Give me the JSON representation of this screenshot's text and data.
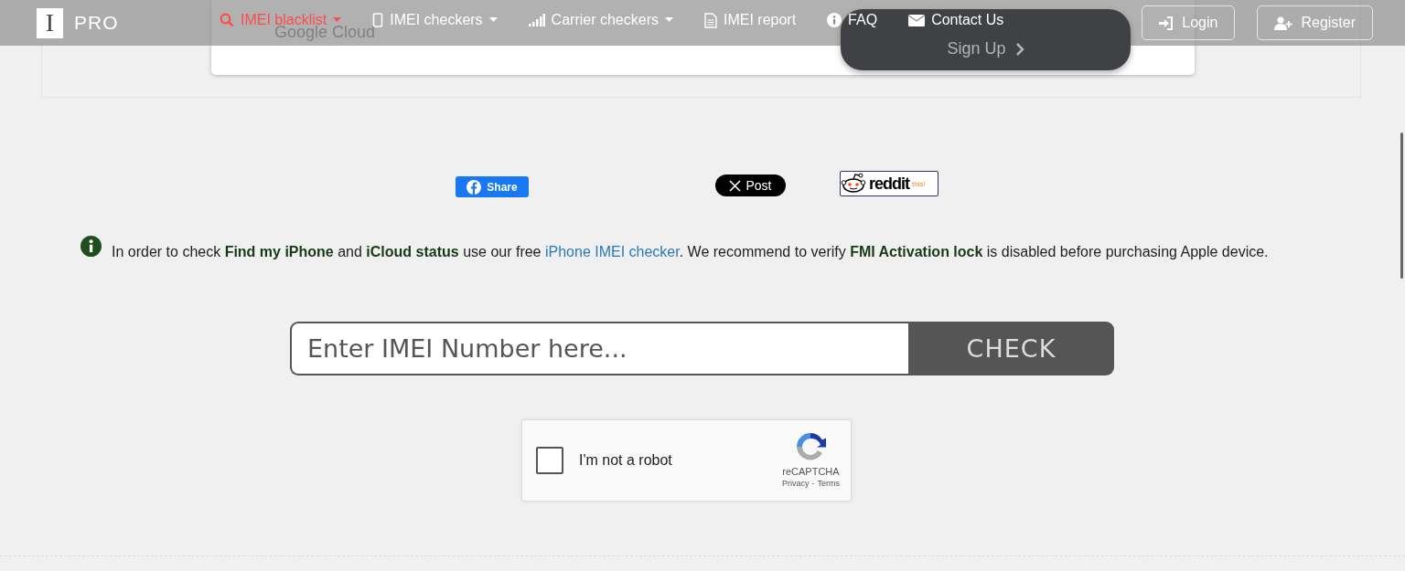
{
  "nav": {
    "logo_letter": "I",
    "logo_text": "PRO",
    "items": [
      {
        "label": "IMEI blacklist",
        "dropdown": true,
        "selected": true
      },
      {
        "label": "IMEI checkers",
        "dropdown": true,
        "selected": false
      },
      {
        "label": "Carrier checkers",
        "dropdown": true,
        "selected": false
      },
      {
        "label": "IMEI report",
        "dropdown": false,
        "selected": false
      },
      {
        "label": "FAQ",
        "dropdown": false,
        "selected": false
      },
      {
        "label": "Contact Us",
        "dropdown": false,
        "selected": false
      }
    ],
    "buttons": [
      {
        "label": "Login"
      },
      {
        "label": "Register"
      }
    ]
  },
  "ad": {
    "brand": "Google Cloud",
    "cta": "Sign Up"
  },
  "share": {
    "facebook": "Share",
    "x": "Post",
    "reddit": "reddit",
    "reddit_suffix": "this!"
  },
  "info": {
    "parts": [
      {
        "kind": "text",
        "text": "In order to check **Find my iPhone** and **iCloud status** use our free "
      },
      {
        "kind": "link",
        "text": "iPhone IMEI checker"
      },
      {
        "kind": "text",
        "text": ". We recommend to verify **FMI Activation lock** is disabled before purchasing Apple device."
      }
    ]
  },
  "form": {
    "placeholder": "Enter IMEI Number here...",
    "button": "CHECK"
  },
  "captcha": {
    "label": "I'm not a robot",
    "checked": false,
    "brand": "reCAPTCHA",
    "privacy": "Privacy",
    "separator": "-",
    "terms": "Terms"
  }
}
